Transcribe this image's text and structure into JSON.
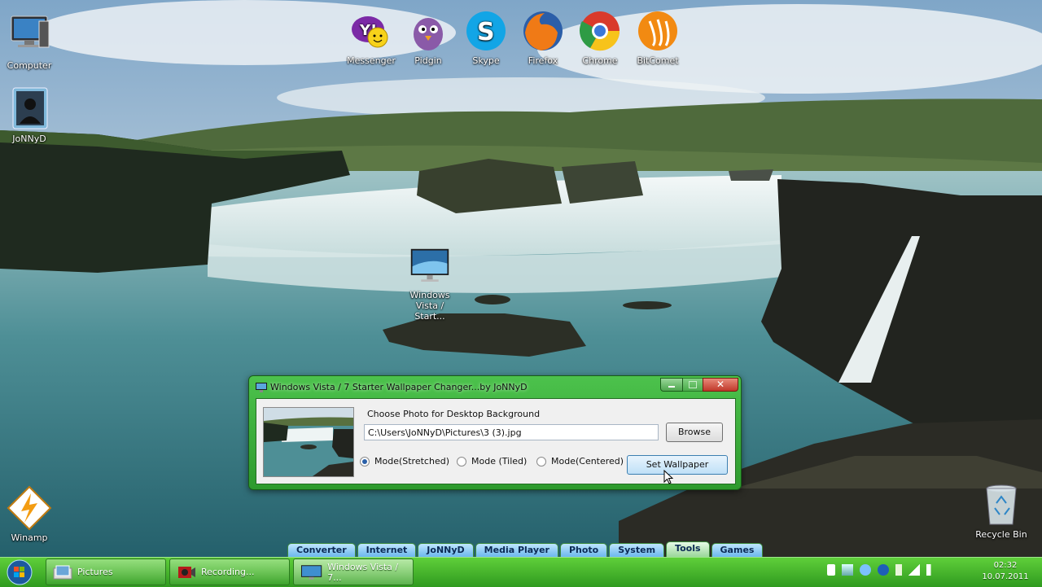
{
  "desktop": {
    "icons_left": [
      {
        "label": "Computer",
        "icon": "computer-icon"
      },
      {
        "label": "JoNNyD",
        "icon": "user-folder-icon"
      },
      {
        "label": "Winamp",
        "icon": "winamp-icon"
      }
    ],
    "icons_top": [
      {
        "label": "Messenger",
        "icon": "yahoo-messenger-icon"
      },
      {
        "label": "Pidgin",
        "icon": "pidgin-icon"
      },
      {
        "label": "Skype",
        "icon": "skype-icon"
      },
      {
        "label": "Firefox",
        "icon": "firefox-icon"
      },
      {
        "label": "Chrome",
        "icon": "chrome-icon"
      },
      {
        "label": "BitComet",
        "icon": "bitcomet-icon"
      }
    ],
    "center_icon": {
      "label": "Windows Vista / Start...",
      "icon": "monitor-icon"
    },
    "recycle_bin": {
      "label": "Recycle Bin",
      "icon": "recycle-bin-icon"
    }
  },
  "dialog": {
    "title": "Windows Vista / 7 Starter Wallpaper Changer...by JoNNyD",
    "choose_label": "Choose Photo for Desktop Background",
    "path_value": "C:\\Users\\JoNNyD\\Pictures\\3 (3).jpg",
    "browse_label": "Browse",
    "modes": [
      {
        "label": "Mode(Stretched)",
        "selected": true
      },
      {
        "label": "Mode (Tiled)",
        "selected": false
      },
      {
        "label": "Mode(Centered)",
        "selected": false
      }
    ],
    "set_wallpaper_label": "Set Wallpaper"
  },
  "tabstrip": {
    "tabs": [
      "Converter",
      "Internet",
      "JoNNyD",
      "Media Player",
      "Photo",
      "System",
      "Tools",
      "Games"
    ],
    "active": "Tools"
  },
  "taskbar": {
    "buttons": [
      {
        "label": "Pictures",
        "icon": "folder-icon"
      },
      {
        "label": "Recording...",
        "icon": "camera-icon"
      },
      {
        "label": "Windows Vista / 7...",
        "icon": "monitor-icon"
      }
    ],
    "time": "02:32",
    "date": "10.07.2011"
  },
  "colors": {
    "taskbar_green": "#3db52a",
    "dialog_green": "#3fae3f",
    "tab_blue": "#8ccaf2"
  }
}
